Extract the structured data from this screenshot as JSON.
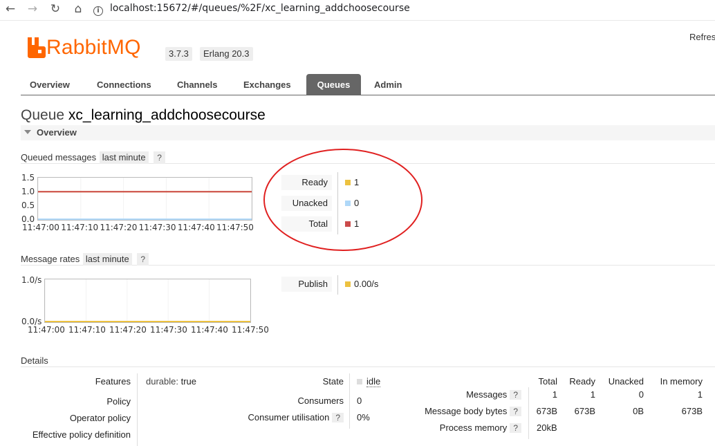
{
  "browser": {
    "back_icon": "arrow-left-icon",
    "forward_icon": "arrow-right-icon",
    "reload_icon": "reload-icon",
    "home_icon": "home-icon",
    "url": "localhost:15672/#/queues/%2F/xc_learning_addchoosecourse"
  },
  "header": {
    "logo_rabbit": "Rabbit",
    "logo_mq": "MQ",
    "version": "3.7.3",
    "erlang": "Erlang 20.3",
    "refresh": "Refres"
  },
  "tabs": [
    {
      "label": "Overview"
    },
    {
      "label": "Connections"
    },
    {
      "label": "Channels"
    },
    {
      "label": "Exchanges"
    },
    {
      "label": "Queues",
      "active": true
    },
    {
      "label": "Admin"
    }
  ],
  "page": {
    "title_prefix": "Queue",
    "queue_name": "xc_learning_addchoosecourse",
    "section": "Overview"
  },
  "queued_messages": {
    "heading": "Queued messages",
    "range": "last minute",
    "help": "?",
    "chart_data": {
      "type": "line",
      "x": [
        "11:47:00",
        "11:47:10",
        "11:47:20",
        "11:47:30",
        "11:47:40",
        "11:47:50"
      ],
      "yticks": [
        "1.5",
        "1.0",
        "0.5",
        "0.0"
      ],
      "ylim": [
        0,
        1.5
      ],
      "series": [
        {
          "name": "Ready",
          "color": "#edc240",
          "values": [
            1,
            1,
            1,
            1,
            1,
            1
          ]
        },
        {
          "name": "Unacked",
          "color": "#afd8f8",
          "values": [
            0,
            0,
            0,
            0,
            0,
            0
          ]
        },
        {
          "name": "Total",
          "color": "#cb4b4b",
          "values": [
            1,
            1,
            1,
            1,
            1,
            1
          ]
        }
      ]
    },
    "legend": [
      {
        "label": "Ready",
        "value": "1",
        "color": "#edc240"
      },
      {
        "label": "Unacked",
        "value": "0",
        "color": "#afd8f8"
      },
      {
        "label": "Total",
        "value": "1",
        "color": "#cb4b4b"
      }
    ]
  },
  "message_rates": {
    "heading": "Message rates",
    "range": "last minute",
    "help": "?",
    "chart_data": {
      "type": "line",
      "x": [
        "11:47:00",
        "11:47:10",
        "11:47:20",
        "11:47:30",
        "11:47:40",
        "11:47:50"
      ],
      "yticks": [
        "1.0/s",
        "0.0/s"
      ],
      "ylim": [
        0,
        1
      ],
      "series": [
        {
          "name": "Publish",
          "color": "#edc240",
          "values": [
            0,
            0,
            0,
            0,
            0,
            0
          ]
        }
      ]
    },
    "legend": [
      {
        "label": "Publish",
        "value": "0.00/s",
        "color": "#edc240"
      }
    ]
  },
  "details": {
    "heading": "Details",
    "features_label": "Features",
    "features_key": "durable:",
    "features_value": "true",
    "policy_label": "Policy",
    "operator_policy_label": "Operator policy",
    "effective_policy_label": "Effective policy definition",
    "state_label": "State",
    "state_value": "idle",
    "consumers_label": "Consumers",
    "consumers_value": "0",
    "consumer_util_label": "Consumer utilisation",
    "consumer_util_help": "?",
    "consumer_util_value": "0%",
    "stats": {
      "columns": [
        "Total",
        "Ready",
        "Unacked",
        "In memory"
      ],
      "rows": [
        {
          "label": "Messages",
          "help": "?",
          "values": [
            "1",
            "1",
            "0",
            "1"
          ]
        },
        {
          "label": "Message body bytes",
          "help": "?",
          "values": [
            "673B",
            "673B",
            "0B",
            "673B"
          ]
        },
        {
          "label": "Process memory",
          "help": "?",
          "values": [
            "20kB"
          ]
        }
      ]
    }
  }
}
